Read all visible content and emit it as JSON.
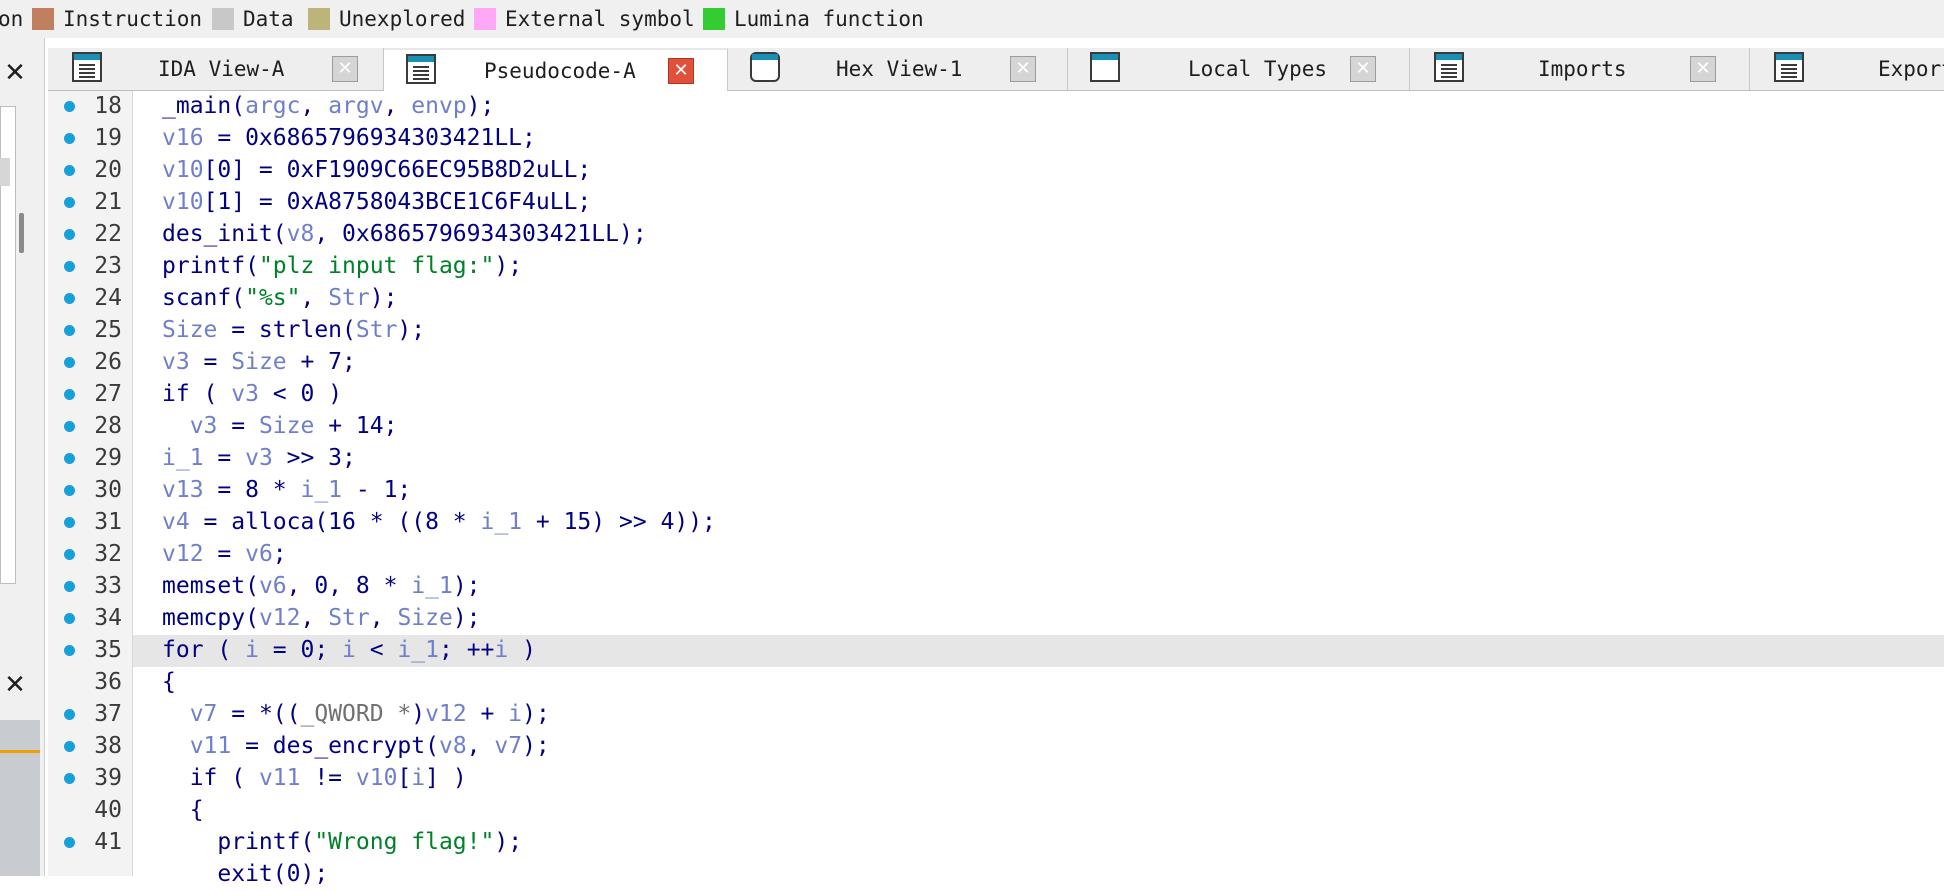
{
  "legend": [
    {
      "label": "on",
      "color": ""
    },
    {
      "label": "Instruction",
      "color": "#c08060"
    },
    {
      "label": "Data",
      "color": "#c8c8c8"
    },
    {
      "label": "Unexplored",
      "color": "#bcb478"
    },
    {
      "label": "External symbol",
      "color": "#ffa8f8"
    },
    {
      "label": "Lumina function",
      "color": "#33cc33"
    }
  ],
  "left_panel": {
    "close_top": "✕",
    "close_bottom": "✕"
  },
  "tabs": [
    {
      "label": "IDA View-A",
      "icon": "listing-icon",
      "close": "✕",
      "active": false
    },
    {
      "label": "Pseudocode-A",
      "icon": "pseudocode-icon",
      "close": "✕",
      "active": true
    },
    {
      "label": "Hex View-1",
      "icon": "hex-icon",
      "close": "✕",
      "active": false
    },
    {
      "label": "Local Types",
      "icon": "types-icon",
      "close": "✕",
      "active": false
    },
    {
      "label": "Imports",
      "icon": "imports-icon",
      "close": "✕",
      "active": false
    },
    {
      "label": "Export",
      "icon": "exports-icon",
      "close": "",
      "active": false
    }
  ],
  "code": {
    "lines": [
      {
        "n": "18",
        "bp": true,
        "hl": false,
        "text": "_main(argc, argv, envp);"
      },
      {
        "n": "19",
        "bp": true,
        "hl": false,
        "text": "v16 = 0x6865796934303421LL;"
      },
      {
        "n": "20",
        "bp": true,
        "hl": false,
        "text": "v10[0] = 0xF1909C66EC95B8D2uLL;"
      },
      {
        "n": "21",
        "bp": true,
        "hl": false,
        "text": "v10[1] = 0xA8758043BCE1C6F4uLL;"
      },
      {
        "n": "22",
        "bp": true,
        "hl": false,
        "text": "des_init(v8, 0x6865796934303421LL);"
      },
      {
        "n": "23",
        "bp": true,
        "hl": false,
        "text": "printf(\"plz input flag:\");"
      },
      {
        "n": "24",
        "bp": true,
        "hl": false,
        "text": "scanf(\"%s\", Str);"
      },
      {
        "n": "25",
        "bp": true,
        "hl": false,
        "text": "Size = strlen(Str);"
      },
      {
        "n": "26",
        "bp": true,
        "hl": false,
        "text": "v3 = Size + 7;"
      },
      {
        "n": "27",
        "bp": true,
        "hl": false,
        "text": "if ( v3 < 0 )"
      },
      {
        "n": "28",
        "bp": true,
        "hl": false,
        "text": "  v3 = Size + 14;"
      },
      {
        "n": "29",
        "bp": true,
        "hl": false,
        "text": "i_1 = v3 >> 3;"
      },
      {
        "n": "30",
        "bp": true,
        "hl": false,
        "text": "v13 = 8 * i_1 - 1;"
      },
      {
        "n": "31",
        "bp": true,
        "hl": false,
        "text": "v4 = alloca(16 * ((8 * i_1 + 15) >> 4));"
      },
      {
        "n": "32",
        "bp": true,
        "hl": false,
        "text": "v12 = v6;"
      },
      {
        "n": "33",
        "bp": true,
        "hl": false,
        "text": "memset(v6, 0, 8 * i_1);"
      },
      {
        "n": "34",
        "bp": true,
        "hl": false,
        "text": "memcpy(v12, Str, Size);"
      },
      {
        "n": "35",
        "bp": true,
        "hl": true,
        "text": "for ( i = 0; i < i_1; ++i )"
      },
      {
        "n": "36",
        "bp": false,
        "hl": false,
        "text": "{"
      },
      {
        "n": "37",
        "bp": true,
        "hl": false,
        "text": "  v7 = *((_QWORD *)v12 + i);"
      },
      {
        "n": "38",
        "bp": true,
        "hl": false,
        "text": "  v11 = des_encrypt(v8, v7);"
      },
      {
        "n": "39",
        "bp": true,
        "hl": false,
        "text": "  if ( v11 != v10[i] )"
      },
      {
        "n": "40",
        "bp": false,
        "hl": false,
        "text": "  {"
      },
      {
        "n": "41",
        "bp": true,
        "hl": false,
        "text": "    printf(\"Wrong flag!\");"
      },
      {
        "n": "",
        "bp": false,
        "hl": false,
        "text": "    exit(0);"
      }
    ]
  }
}
